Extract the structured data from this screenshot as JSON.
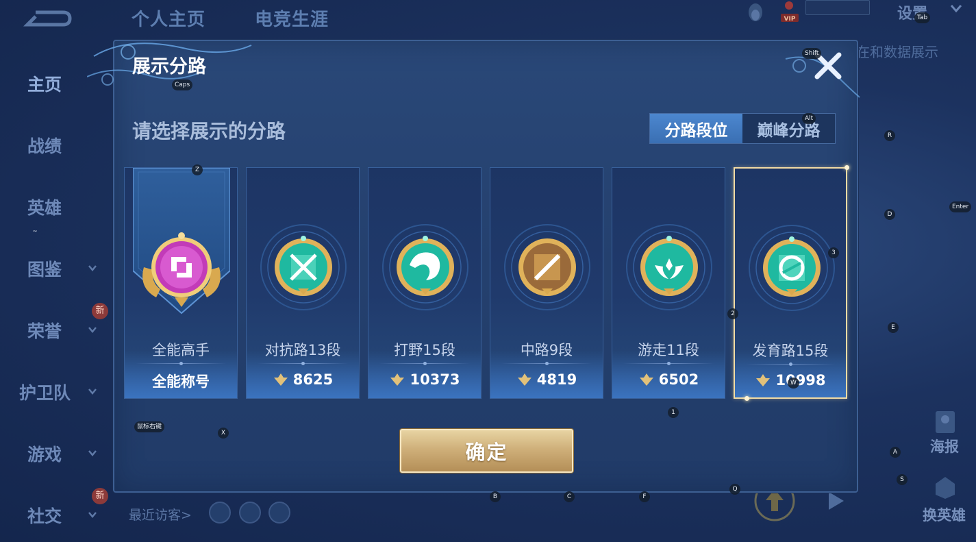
{
  "background": {
    "top_tabs": [
      "个人主页",
      "电竞生涯"
    ],
    "settings_label": "设置",
    "right_partial_label": "在和数据展示",
    "sidebar": [
      {
        "label": "主页",
        "active": true
      },
      {
        "label": "战绩"
      },
      {
        "label": "英雄"
      },
      {
        "label": "图鉴"
      },
      {
        "label": "荣誉",
        "badge": "新"
      },
      {
        "label": "护卫队"
      },
      {
        "label": "游戏"
      },
      {
        "label": "社交",
        "badge": "新"
      }
    ],
    "recent_visitors": "最近访客>",
    "right_actions": [
      "海报",
      "换英雄"
    ],
    "vip_label": "VIP"
  },
  "modal": {
    "title": "展示分路",
    "subtitle": "请选择展示的分路",
    "toggle": {
      "options": [
        "分路段位",
        "巅峰分路"
      ],
      "selected": "分路段位"
    },
    "cards": [
      {
        "name": "全能高手",
        "label": "全能称号",
        "icon": "all-round-badge-icon"
      },
      {
        "name": "对抗路13段",
        "points": "8625",
        "icon": "clash-lane-badge-icon"
      },
      {
        "name": "打野15段",
        "points": "10373",
        "icon": "jungle-badge-icon"
      },
      {
        "name": "中路9段",
        "points": "4819",
        "icon": "mid-lane-badge-icon"
      },
      {
        "name": "游走11段",
        "points": "6502",
        "icon": "roam-badge-icon"
      },
      {
        "name": "发育路15段",
        "points": "10998",
        "icon": "farm-lane-badge-icon",
        "selected": true
      }
    ],
    "confirm_label": "确定"
  },
  "key_hints": {
    "caps": "Caps",
    "shift": "Shift",
    "tab": "Tab",
    "alt": "Alt",
    "enter": "Enter",
    "z": "Z",
    "x": "X",
    "r": "R",
    "d": "D",
    "e": "E",
    "a": "A",
    "s": "S",
    "w": "W",
    "q": "Q",
    "b": "B",
    "c": "C",
    "f": "F",
    "k1": "1",
    "k2": "2",
    "k3": "3",
    "tilde": "~",
    "mouse_right": "鼠标右键"
  },
  "colors": {
    "modal_bg": "#24406e",
    "toggle_active": "#3f78c0",
    "confirm_gold": "#cfb07a",
    "selected_border": "#f3dca4",
    "badge_teal": "#1fb9a0",
    "badge_gold": "#d9a94f",
    "badge_magenta": "#c23bb8"
  }
}
